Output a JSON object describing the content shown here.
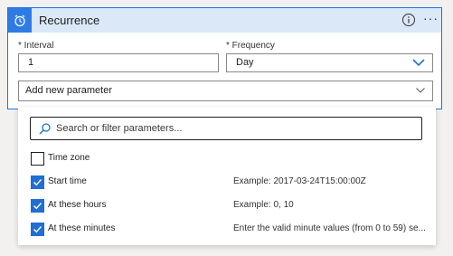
{
  "card": {
    "title": "Recurrence",
    "icons": {
      "app": "alarm-clock-icon",
      "info": "info-icon",
      "more": "more-options-icon"
    },
    "accent": "#1a73e8",
    "header_bg": "#dbe8f7"
  },
  "interval": {
    "label": "* Interval",
    "value": "1"
  },
  "frequency": {
    "label": "* Frequency",
    "value": "Day"
  },
  "add_parameter": {
    "label": "Add new parameter"
  },
  "panel": {
    "search_placeholder": "Search or filter parameters...",
    "options": [
      {
        "label": "Time zone",
        "checked": false,
        "example": ""
      },
      {
        "label": "Start time",
        "checked": true,
        "example": "Example: 2017-03-24T15:00:00Z"
      },
      {
        "label": "At these hours",
        "checked": true,
        "example": "Example: 0, 10"
      },
      {
        "label": "At these minutes",
        "checked": true,
        "example": "Enter the valid minute values (from 0 to 59) se..."
      }
    ]
  }
}
